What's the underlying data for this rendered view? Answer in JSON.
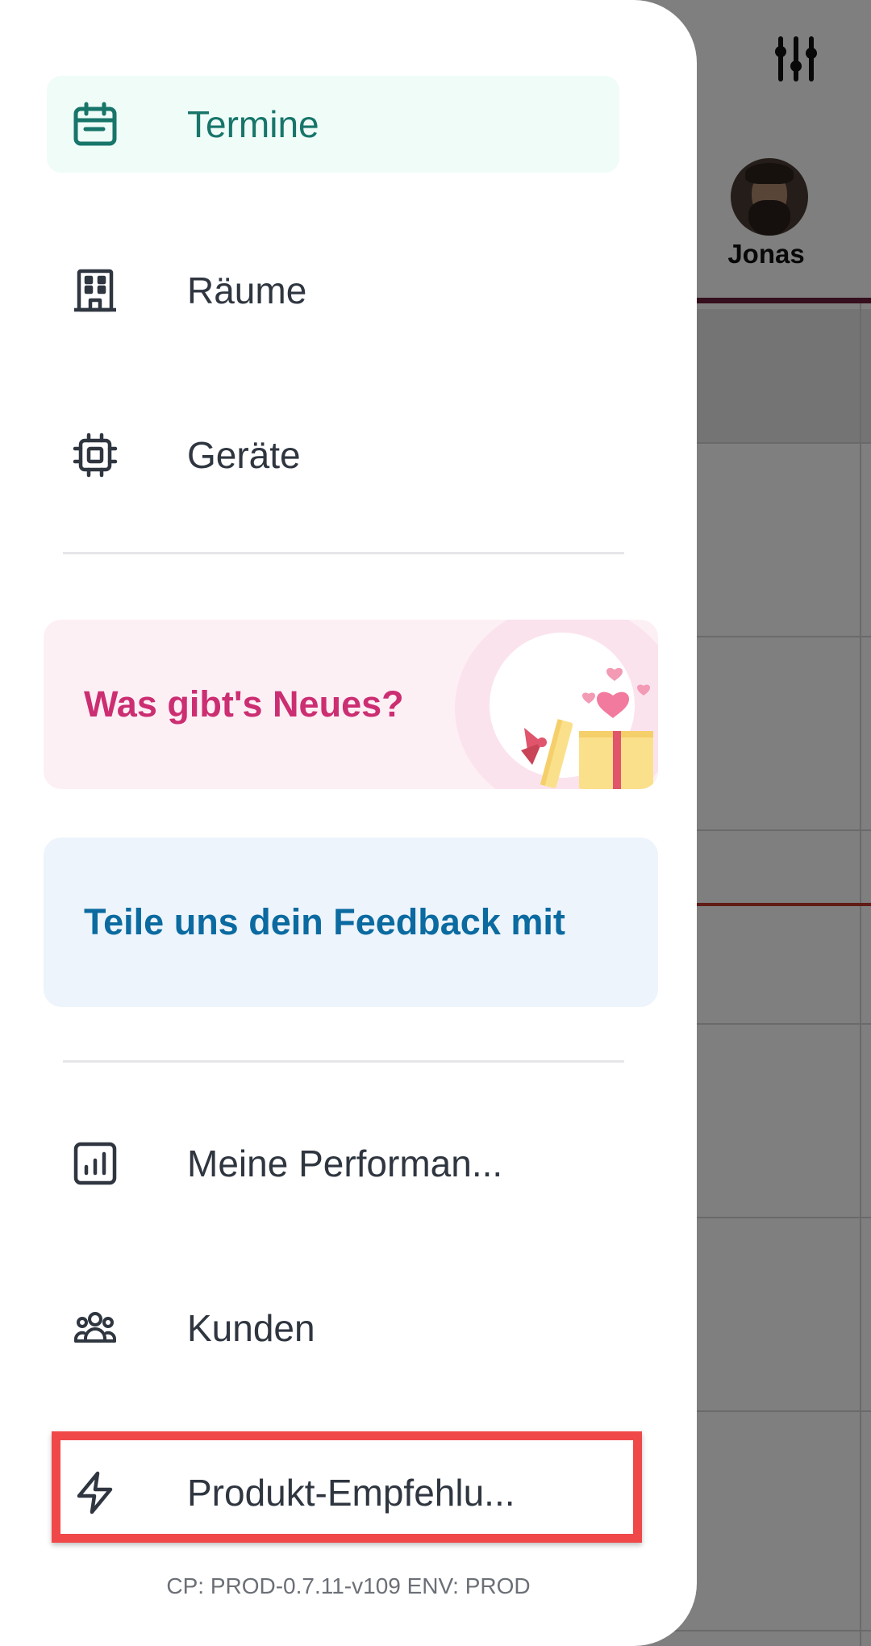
{
  "background": {
    "staff_name": "Jonas",
    "filter_icon": "sliders-icon"
  },
  "drawer": {
    "nav_primary": [
      {
        "label": "Termine",
        "icon": "calendar-icon",
        "active": true
      },
      {
        "label": "Räume",
        "icon": "building-icon",
        "active": false
      },
      {
        "label": "Geräte",
        "icon": "chip-icon",
        "active": false
      }
    ],
    "promo_news": {
      "text": "Was gibt's Neues?",
      "icon": "gift-icon"
    },
    "promo_feedback": {
      "text": "Teile uns dein Feedback mit"
    },
    "nav_secondary": [
      {
        "label": "Meine Performan...",
        "icon": "chart-icon"
      },
      {
        "label": "Kunden",
        "icon": "users-icon"
      },
      {
        "label": "Produkt-Empfehlu...",
        "icon": "lightning-icon",
        "highlighted": true
      }
    ],
    "version": "CP: PROD-0.7.11-v109 ENV: PROD"
  },
  "colors": {
    "active_bg": "#effcf7",
    "active_text": "#17756a",
    "news_text": "#cc2e72",
    "feedback_text": "#0b6aa0",
    "highlight": "#f04848"
  }
}
